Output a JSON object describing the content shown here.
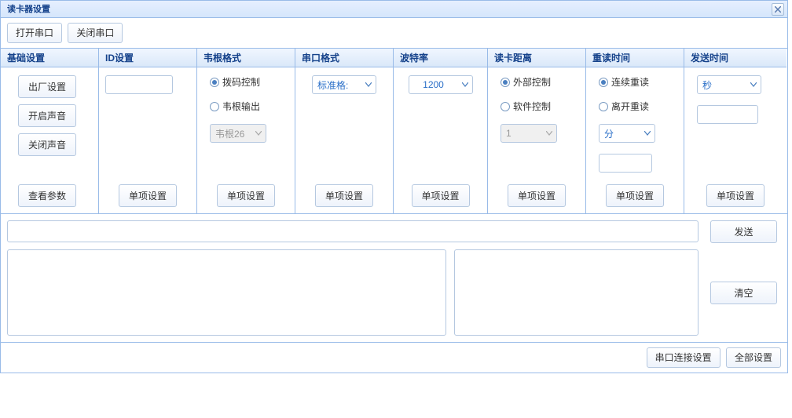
{
  "window": {
    "title": "读卡器设置"
  },
  "toolbar": {
    "open_port": "打开串口",
    "close_port": "关闭串口"
  },
  "columns": {
    "basic": {
      "header": "基础设置",
      "factory": "出厂设置",
      "sound_on": "开启声音",
      "sound_off": "关闭声音",
      "view_params": "查看参数"
    },
    "id": {
      "header": "ID设置",
      "value": "",
      "single": "单项设置"
    },
    "wiegand": {
      "header": "韦根格式",
      "dial_control": "拨码控制",
      "wiegand_output": "韦根输出",
      "wiegand_select": "韦根26",
      "single": "单项设置"
    },
    "serial_fmt": {
      "header": "串口格式",
      "standard_fmt": "标准格:",
      "single": "单项设置"
    },
    "baud": {
      "header": "波特率",
      "value": "1200",
      "single": "单项设置"
    },
    "distance": {
      "header": "读卡距离",
      "external": "外部控制",
      "software": "软件控制",
      "value": "1",
      "single": "单项设置"
    },
    "reread": {
      "header": "重读时间",
      "continuous": "连续重读",
      "leave": "离开重读",
      "unit": "分",
      "value": "",
      "single": "单项设置"
    },
    "send_time": {
      "header": "发送时间",
      "unit": "秒",
      "value": "",
      "single": "单项设置"
    }
  },
  "bottom": {
    "send": "发送",
    "clear": "清空"
  },
  "footer": {
    "serial_settings": "串口连接设置",
    "all_settings": "全部设置"
  }
}
